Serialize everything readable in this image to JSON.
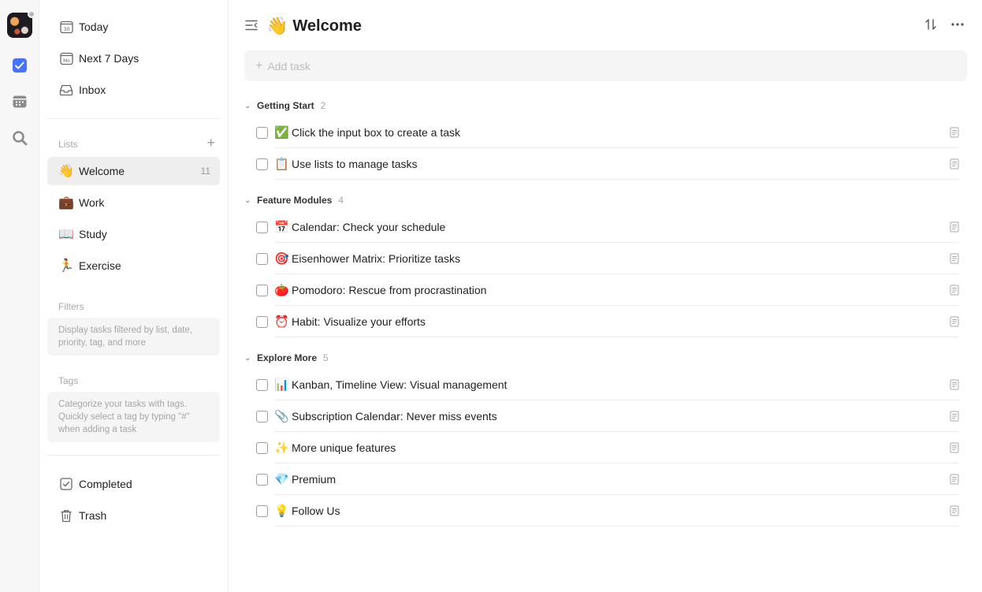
{
  "sidebar": {
    "smart": [
      {
        "label": "Today",
        "icon": "calendar-30-icon"
      },
      {
        "label": "Next 7 Days",
        "icon": "calendar-mo-icon"
      },
      {
        "label": "Inbox",
        "icon": "inbox-icon"
      }
    ],
    "lists_title": "Lists",
    "lists": [
      {
        "label": "Welcome",
        "emoji": "👋",
        "count": "11"
      },
      {
        "label": "Work",
        "emoji": "💼",
        "count": ""
      },
      {
        "label": "Study",
        "emoji": "📖",
        "count": ""
      },
      {
        "label": "Exercise",
        "emoji": "🏃",
        "count": ""
      }
    ],
    "filters_title": "Filters",
    "filters_hint": "Display tasks filtered by list, date, priority, tag, and more",
    "tags_title": "Tags",
    "tags_hint": "Categorize your tasks with tags. Quickly select a tag by typing \"#\" when adding a task",
    "completed": "Completed",
    "trash": "Trash"
  },
  "main": {
    "title": "Welcome",
    "title_emoji": "👋",
    "add_placeholder": "Add task",
    "groups": [
      {
        "name": "Getting Start",
        "count": "2",
        "tasks": [
          {
            "emoji": "✅",
            "text": "Click the input box to create a task"
          },
          {
            "emoji": "📋",
            "text": "Use lists to manage tasks"
          }
        ]
      },
      {
        "name": "Feature Modules",
        "count": "4",
        "tasks": [
          {
            "emoji": "📅",
            "text": "Calendar: Check your schedule"
          },
          {
            "emoji": "🎯",
            "text": "Eisenhower Matrix: Prioritize tasks"
          },
          {
            "emoji": "🍅",
            "text": "Pomodoro: Rescue from procrastination"
          },
          {
            "emoji": "⏰",
            "text": "Habit: Visualize your efforts"
          }
        ]
      },
      {
        "name": "Explore More",
        "count": "5",
        "tasks": [
          {
            "emoji": "📊",
            "text": "Kanban, Timeline View: Visual management"
          },
          {
            "emoji": "📎",
            "text": "Subscription Calendar: Never miss events"
          },
          {
            "emoji": "✨",
            "text": "More unique features"
          },
          {
            "emoji": "💎",
            "text": "Premium"
          },
          {
            "emoji": "💡",
            "text": "Follow Us"
          }
        ]
      }
    ]
  },
  "colors": {
    "accent": "#4772fa",
    "active_bg": "#eeeeee",
    "muted": "#a8a8a8"
  }
}
